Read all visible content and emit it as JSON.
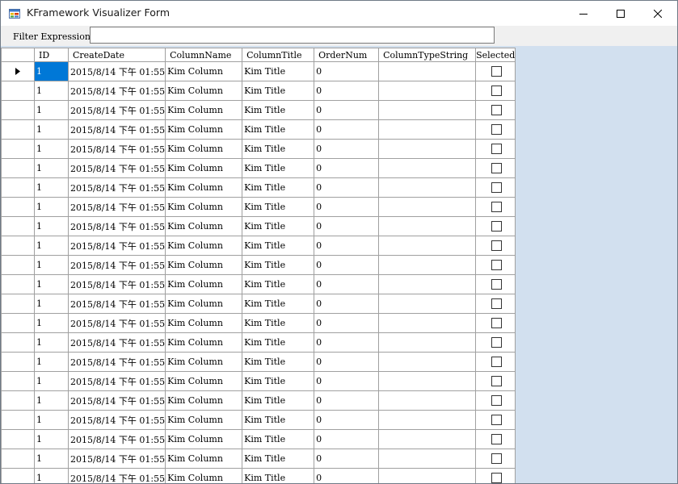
{
  "window": {
    "title": "KFramework Visualizer Form",
    "icon": "app-form-icon",
    "controls": [
      "minimize-icon",
      "maximize-icon",
      "close-icon"
    ]
  },
  "filter": {
    "label": "Filter Expression：",
    "value": "",
    "placeholder": ""
  },
  "grid": {
    "columns": [
      "ID",
      "CreateDate",
      "ColumnName",
      "ColumnTitle",
      "OrderNum",
      "ColumnTypeString",
      "Selected"
    ],
    "current_row": 0,
    "current_row_icon": "row-pointer-arrow-icon",
    "selected_cell_color": "#0078d7",
    "background_color": "#d2e0ef",
    "rows": [
      {
        "id": "1",
        "create_date": "2015/8/14 下午 01:55",
        "column_name": "Kim Column",
        "column_title": "Kim Title",
        "order_num": "0",
        "column_type_string": "",
        "selected": false
      },
      {
        "id": "1",
        "create_date": "2015/8/14 下午 01:55",
        "column_name": "Kim Column",
        "column_title": "Kim Title",
        "order_num": "0",
        "column_type_string": "",
        "selected": false
      },
      {
        "id": "1",
        "create_date": "2015/8/14 下午 01:55",
        "column_name": "Kim Column",
        "column_title": "Kim Title",
        "order_num": "0",
        "column_type_string": "",
        "selected": false
      },
      {
        "id": "1",
        "create_date": "2015/8/14 下午 01:55",
        "column_name": "Kim Column",
        "column_title": "Kim Title",
        "order_num": "0",
        "column_type_string": "",
        "selected": false
      },
      {
        "id": "1",
        "create_date": "2015/8/14 下午 01:55",
        "column_name": "Kim Column",
        "column_title": "Kim Title",
        "order_num": "0",
        "column_type_string": "",
        "selected": false
      },
      {
        "id": "1",
        "create_date": "2015/8/14 下午 01:55",
        "column_name": "Kim Column",
        "column_title": "Kim Title",
        "order_num": "0",
        "column_type_string": "",
        "selected": false
      },
      {
        "id": "1",
        "create_date": "2015/8/14 下午 01:55",
        "column_name": "Kim Column",
        "column_title": "Kim Title",
        "order_num": "0",
        "column_type_string": "",
        "selected": false
      },
      {
        "id": "1",
        "create_date": "2015/8/14 下午 01:55",
        "column_name": "Kim Column",
        "column_title": "Kim Title",
        "order_num": "0",
        "column_type_string": "",
        "selected": false
      },
      {
        "id": "1",
        "create_date": "2015/8/14 下午 01:55",
        "column_name": "Kim Column",
        "column_title": "Kim Title",
        "order_num": "0",
        "column_type_string": "",
        "selected": false
      },
      {
        "id": "1",
        "create_date": "2015/8/14 下午 01:55",
        "column_name": "Kim Column",
        "column_title": "Kim Title",
        "order_num": "0",
        "column_type_string": "",
        "selected": false
      },
      {
        "id": "1",
        "create_date": "2015/8/14 下午 01:55",
        "column_name": "Kim Column",
        "column_title": "Kim Title",
        "order_num": "0",
        "column_type_string": "",
        "selected": false
      },
      {
        "id": "1",
        "create_date": "2015/8/14 下午 01:55",
        "column_name": "Kim Column",
        "column_title": "Kim Title",
        "order_num": "0",
        "column_type_string": "",
        "selected": false
      },
      {
        "id": "1",
        "create_date": "2015/8/14 下午 01:55",
        "column_name": "Kim Column",
        "column_title": "Kim Title",
        "order_num": "0",
        "column_type_string": "",
        "selected": false
      },
      {
        "id": "1",
        "create_date": "2015/8/14 下午 01:55",
        "column_name": "Kim Column",
        "column_title": "Kim Title",
        "order_num": "0",
        "column_type_string": "",
        "selected": false
      },
      {
        "id": "1",
        "create_date": "2015/8/14 下午 01:55",
        "column_name": "Kim Column",
        "column_title": "Kim Title",
        "order_num": "0",
        "column_type_string": "",
        "selected": false
      },
      {
        "id": "1",
        "create_date": "2015/8/14 下午 01:55",
        "column_name": "Kim Column",
        "column_title": "Kim Title",
        "order_num": "0",
        "column_type_string": "",
        "selected": false
      },
      {
        "id": "1",
        "create_date": "2015/8/14 下午 01:55",
        "column_name": "Kim Column",
        "column_title": "Kim Title",
        "order_num": "0",
        "column_type_string": "",
        "selected": false
      },
      {
        "id": "1",
        "create_date": "2015/8/14 下午 01:55",
        "column_name": "Kim Column",
        "column_title": "Kim Title",
        "order_num": "0",
        "column_type_string": "",
        "selected": false
      },
      {
        "id": "1",
        "create_date": "2015/8/14 下午 01:55",
        "column_name": "Kim Column",
        "column_title": "Kim Title",
        "order_num": "0",
        "column_type_string": "",
        "selected": false
      },
      {
        "id": "1",
        "create_date": "2015/8/14 下午 01:55",
        "column_name": "Kim Column",
        "column_title": "Kim Title",
        "order_num": "0",
        "column_type_string": "",
        "selected": false
      },
      {
        "id": "1",
        "create_date": "2015/8/14 下午 01:55",
        "column_name": "Kim Column",
        "column_title": "Kim Title",
        "order_num": "0",
        "column_type_string": "",
        "selected": false
      },
      {
        "id": "1",
        "create_date": "2015/8/14 下午 01:55",
        "column_name": "Kim Column",
        "column_title": "Kim Title",
        "order_num": "0",
        "column_type_string": "",
        "selected": false
      }
    ]
  }
}
